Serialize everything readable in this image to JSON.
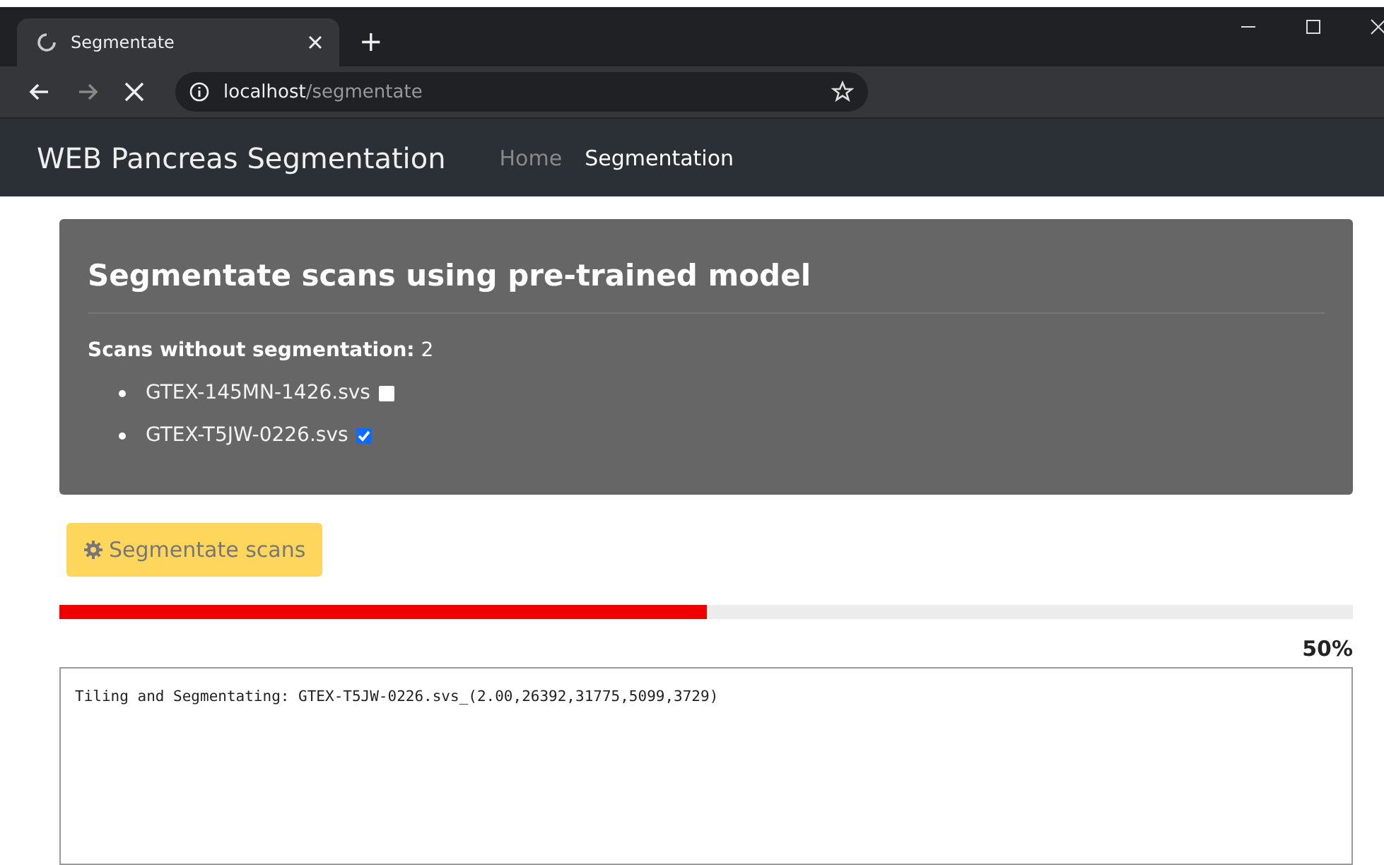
{
  "browser": {
    "tab_title": "Segmentate",
    "new_tab": "+",
    "url_host": "localhost",
    "url_path": "/segmentate"
  },
  "navbar": {
    "brand": "WEB Pancreas Segmentation",
    "links": [
      {
        "label": "Home",
        "selected": false
      },
      {
        "label": "Segmentation",
        "selected": true
      }
    ]
  },
  "card": {
    "title": "Segmentate scans using pre-trained model",
    "count_label": "Scans without segmentation:",
    "count": "2",
    "scans": [
      {
        "name": "GTEX-145MN-1426.svs",
        "checked": false
      },
      {
        "name": "GTEX-T5JW-0226.svs",
        "checked": true
      }
    ]
  },
  "button": {
    "label": "Segmentate scans",
    "disabled": true
  },
  "progress": {
    "level": 0.5,
    "reading": "50%"
  },
  "log": {
    "value": "Tiling and Segmentating: GTEX-T5JW-0226.svs_(2.00,26392,31775,5099,3729)"
  }
}
